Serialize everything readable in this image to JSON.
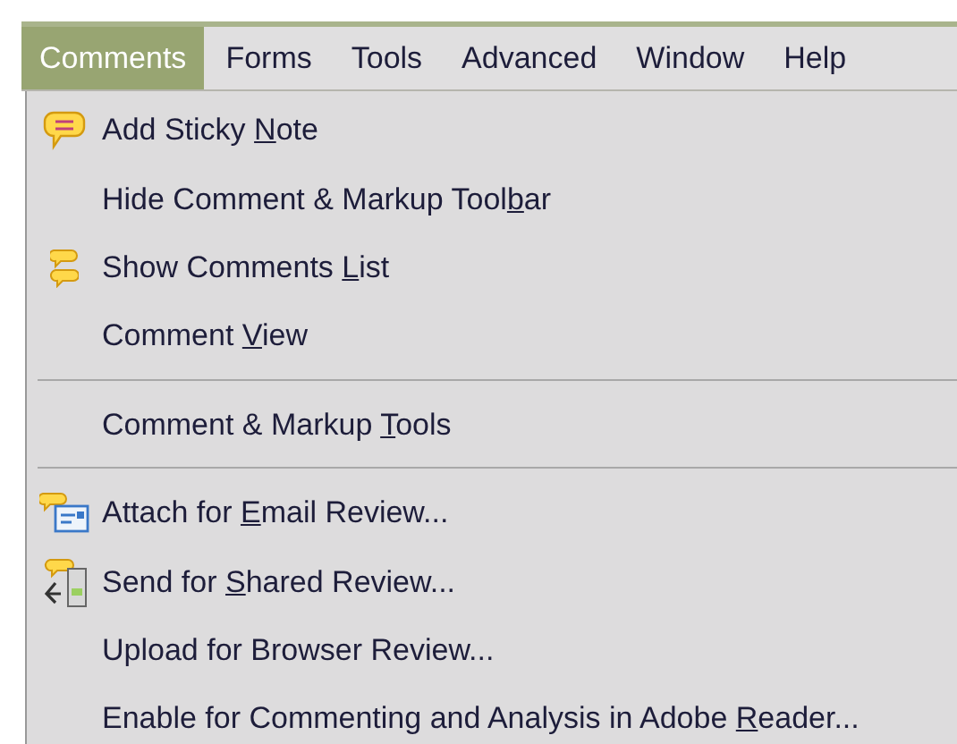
{
  "menubar": [
    {
      "label": "Comments",
      "selected": true
    },
    {
      "label": "Forms",
      "selected": false
    },
    {
      "label": "Tools",
      "selected": false
    },
    {
      "label": "Advanced",
      "selected": false
    },
    {
      "label": "Window",
      "selected": false
    },
    {
      "label": "Help",
      "selected": false
    }
  ],
  "menu": [
    {
      "kind": "sticky-note",
      "text_before": "Add Sticky ",
      "mnemonic": "N",
      "text_after": "ote"
    },
    {
      "kind": "plain",
      "text_before": "Hide Comment & Markup Tool",
      "mnemonic": "b",
      "text_after": "ar"
    },
    {
      "kind": "comments-list",
      "text_before": "Show Comments ",
      "mnemonic": "L",
      "text_after": "ist"
    },
    {
      "kind": "plain",
      "text_before": "Comment ",
      "mnemonic": "V",
      "text_after": "iew"
    },
    {
      "kind": "separator"
    },
    {
      "kind": "plain",
      "text_before": "Comment & Markup ",
      "mnemonic": "T",
      "text_after": "ools"
    },
    {
      "kind": "separator"
    },
    {
      "kind": "email-review",
      "text_before": "Attach for ",
      "mnemonic": "E",
      "text_after": "mail Review..."
    },
    {
      "kind": "shared-review",
      "text_before": "Send for ",
      "mnemonic": "S",
      "text_after": "hared Review..."
    },
    {
      "kind": "plain",
      "text_before": "Upload for Browser Review..."
    },
    {
      "kind": "plain",
      "text_before": "Enable for Commenting and Analysis in Adobe ",
      "mnemonic": "R",
      "text_after": "eader..."
    }
  ]
}
